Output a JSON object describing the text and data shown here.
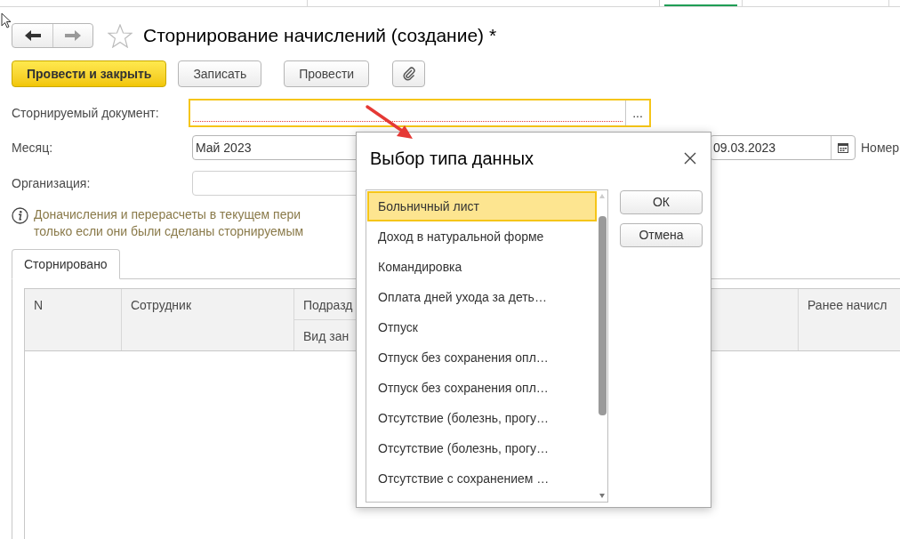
{
  "title": "Сторнирование начислений (создание) *",
  "toolbar": [
    {
      "label": "Провести и закрыть",
      "kind": "primary"
    },
    {
      "label": "Записать",
      "kind": "plain"
    },
    {
      "label": "Провести",
      "kind": "plain"
    },
    {
      "kind": "attach"
    }
  ],
  "document_field": {
    "label": "Сторнируемый документ:",
    "button": "..."
  },
  "month_field": {
    "label": "Месяц:",
    "value": "Май 2023"
  },
  "date_field": {
    "value": "09.03.2023"
  },
  "number_label": "Номер",
  "organization_field": {
    "label": "Организация:"
  },
  "info_lines": [
    "Доначисления и перерасчеты в текущем пери",
    "только если они были сделаны сторнируемым"
  ],
  "tabs": [
    {
      "label": "Сторнировано",
      "selected": true
    }
  ],
  "table": {
    "columns": [
      {
        "top": "N"
      },
      {
        "top": "Сотрудник"
      },
      {
        "top": "Подразд",
        "bottom": "Вид зан"
      },
      {},
      {
        "top": "Ранее начисл"
      }
    ]
  },
  "dialog": {
    "title": "Выбор типа данных",
    "items": [
      {
        "label": "Больничный лист",
        "selected": true
      },
      {
        "label": "Доход в натуральной форме",
        "selected": false
      },
      {
        "label": "Командировка",
        "selected": false
      },
      {
        "label": "Оплата дней ухода за деть…",
        "selected": false
      },
      {
        "label": "Отпуск",
        "selected": false
      },
      {
        "label": "Отпуск без сохранения опл…",
        "selected": false
      },
      {
        "label": "Отпуск без сохранения опл…",
        "selected": false
      },
      {
        "label": "Отсутствие (болезнь, прогу…",
        "selected": false
      },
      {
        "label": "Отсутствие (болезнь, прогу…",
        "selected": false
      },
      {
        "label": "Отсутствие с сохранением …",
        "selected": false
      }
    ],
    "buttons": [
      "ОК",
      "Отмена"
    ]
  }
}
